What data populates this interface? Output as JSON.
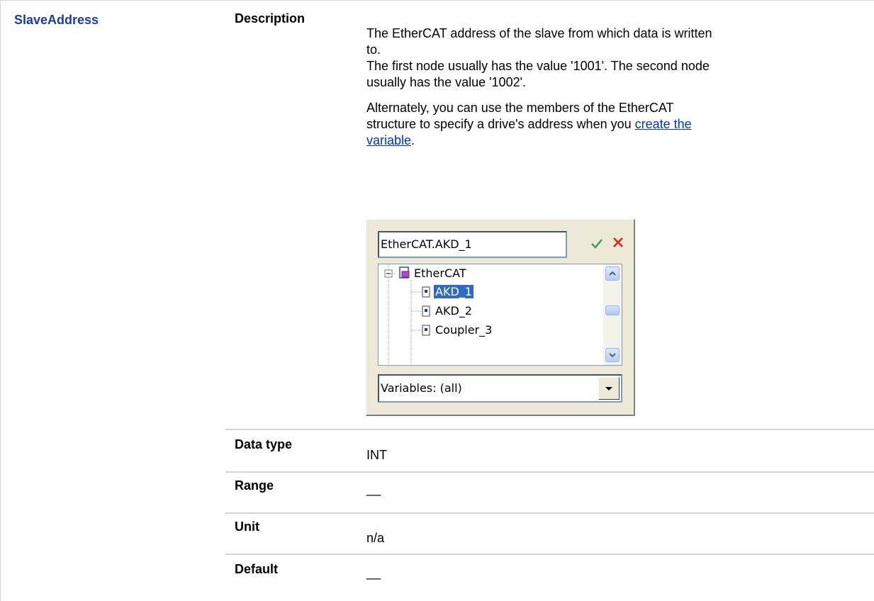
{
  "parameter": {
    "name": "SlaveAddress",
    "description_label": "Description",
    "description": {
      "p1_line1": "The EtherCAT address of the slave from which data is written",
      "p1_line2": "to.",
      "p1_line3": "The first node usually has the value '1001'. The second node",
      "p1_line4": "usually has the value '1002'.",
      "p2_line1": "Alternately, you can use the members of the EtherCAT",
      "p2_line2_text": "structure to specify a drive's address when you ",
      "p2_link_part1": "create the",
      "p2_link_part2": "variable",
      "p2_end": "."
    }
  },
  "dialog": {
    "input_value": "EtherCAT.AKD_1",
    "ok_icon": "checkmark-icon",
    "cancel_icon": "x-icon",
    "tree": {
      "root": "EtherCAT",
      "children": [
        "AKD_1",
        "AKD_2",
        "Coupler_3"
      ],
      "selected": "AKD_1"
    },
    "filter_value": "Variables: (all)"
  },
  "rows": [
    {
      "label": "Data type",
      "value": "INT"
    },
    {
      "label": "Range",
      "value": "__"
    },
    {
      "label": "Unit",
      "value": "n/a"
    },
    {
      "label": "Default",
      "value": "__"
    }
  ],
  "colors": {
    "param_name": "#1c3aa6",
    "link": "#0033cc",
    "selection": "#316ac5",
    "grid_line": "#d4d4d4"
  }
}
